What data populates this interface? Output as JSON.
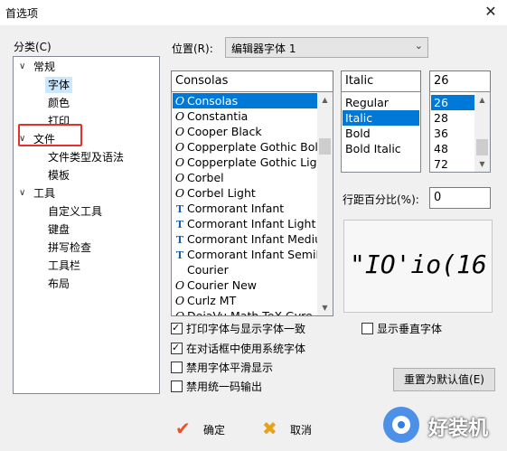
{
  "window": {
    "title": "首选项",
    "close_glyph": "✕"
  },
  "category": {
    "label": "分类(C)",
    "items": [
      {
        "label": "常规",
        "toggle": "∨",
        "level": 0
      },
      {
        "label": "字体",
        "level": 1,
        "selected": true
      },
      {
        "label": "颜色",
        "level": 1
      },
      {
        "label": "打印",
        "level": 1
      },
      {
        "label": "文件",
        "toggle": "∨",
        "level": 0
      },
      {
        "label": "文件类型及语法",
        "level": 1
      },
      {
        "label": "模板",
        "level": 1
      },
      {
        "label": "工具",
        "toggle": "∨",
        "level": 0
      },
      {
        "label": "自定义工具",
        "level": 1
      },
      {
        "label": "键盘",
        "level": 1
      },
      {
        "label": "拼写检查",
        "level": 1
      },
      {
        "label": "工具栏",
        "level": 1
      },
      {
        "label": "布局",
        "level": 1
      }
    ]
  },
  "position": {
    "label": "位置(R):",
    "value": "编辑器字体 1",
    "arrow_icon": "chevron-down-icon"
  },
  "font": {
    "current": "Consolas",
    "list": [
      {
        "name": "Consolas",
        "icon": "O",
        "selected": true
      },
      {
        "name": "Constantia",
        "icon": "O"
      },
      {
        "name": "Cooper Black",
        "icon": "O"
      },
      {
        "name": "Copperplate Gothic Bold",
        "icon": "O"
      },
      {
        "name": "Copperplate Gothic Light",
        "icon": "O"
      },
      {
        "name": "Corbel",
        "icon": "O"
      },
      {
        "name": "Corbel Light",
        "icon": "O"
      },
      {
        "name": "Cormorant Infant",
        "icon": "T"
      },
      {
        "name": "Cormorant Infant Light",
        "icon": "T"
      },
      {
        "name": "Cormorant Infant Medium",
        "icon": "T"
      },
      {
        "name": "Cormorant Infant SemiBold",
        "icon": "T"
      },
      {
        "name": "Courier",
        "icon": ""
      },
      {
        "name": "Courier New",
        "icon": "O"
      },
      {
        "name": "Curlz MT",
        "icon": "O"
      },
      {
        "name": "DejaVu Math TeX Gyre",
        "icon": "O"
      }
    ]
  },
  "style": {
    "current": "Italic",
    "list": [
      {
        "name": "Regular"
      },
      {
        "name": "Italic",
        "selected": true
      },
      {
        "name": "Bold"
      },
      {
        "name": "Bold Italic"
      }
    ]
  },
  "size": {
    "current": "26",
    "list": [
      {
        "name": "26",
        "selected": true
      },
      {
        "name": "28"
      },
      {
        "name": "36"
      },
      {
        "name": "48"
      },
      {
        "name": "72"
      }
    ]
  },
  "line_spacing": {
    "label": "行距百分比(%):",
    "value": "0"
  },
  "preview": {
    "text": "\"IO'io(16"
  },
  "options": {
    "print_match": {
      "label": "打印字体与显示字体一致",
      "checked": true
    },
    "vertical_fonts": {
      "label": "显示垂直字体",
      "checked": false
    },
    "system_font": {
      "label": "在对话框中使用系统字体",
      "checked": true
    },
    "disable_smoothing": {
      "label": "禁用字体平滑显示",
      "checked": false
    },
    "disable_unicode": {
      "label": "禁用统一码输出",
      "checked": false
    }
  },
  "buttons": {
    "reset": "重置为默认值(E)",
    "ok": "确定",
    "cancel": "取消",
    "ok_icon": "✔",
    "cancel_icon": "✖"
  },
  "colors": {
    "selection": "#0078d7",
    "tree_selection": "#cce8ff",
    "highlight_box": "#e2322d",
    "ok_icon": "#e8542a",
    "cancel_icon": "#e8a21a"
  },
  "watermark": {
    "text": "好装机"
  }
}
